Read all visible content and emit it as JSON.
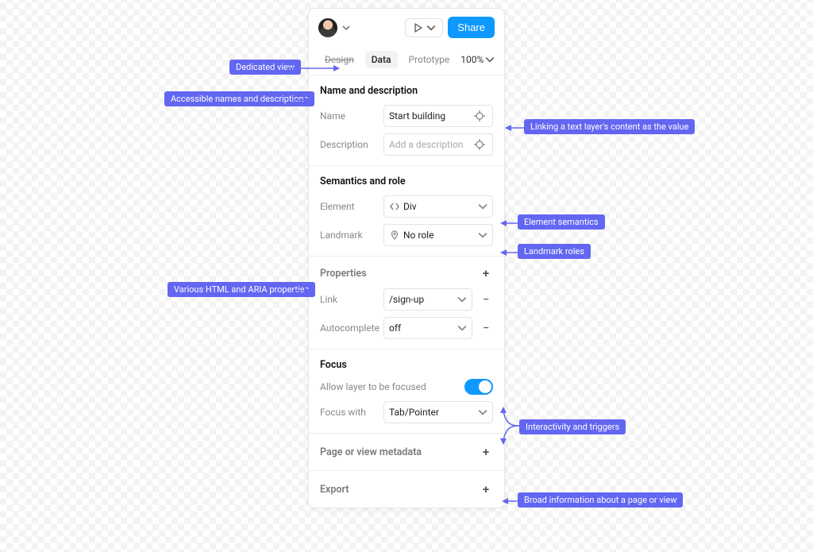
{
  "header": {
    "share_label": "Share"
  },
  "tabs": {
    "design": "Design",
    "data": "Data",
    "prototype": "Prototype",
    "zoom": "100%"
  },
  "sections": {
    "name_desc": {
      "title": "Name and description",
      "name_label": "Name",
      "name_value": "Start building",
      "desc_label": "Description",
      "desc_placeholder": "Add a description"
    },
    "semantics": {
      "title": "Semantics and role",
      "element_label": "Element",
      "element_value": "Div",
      "landmark_label": "Landmark",
      "landmark_value": "No role"
    },
    "properties": {
      "title": "Properties",
      "link_label": "Link",
      "link_value": "/sign-up",
      "autocomplete_label": "Autocomplete",
      "autocomplete_value": "off"
    },
    "focus": {
      "title": "Focus",
      "allow_label": "Allow layer to be focused",
      "focus_with_label": "Focus with",
      "focus_with_value": "Tab/Pointer"
    },
    "metadata": {
      "title": "Page or view metadata"
    },
    "export": {
      "title": "Export"
    }
  },
  "annotations": {
    "dedicated_view": "Dedicated view",
    "accessible_names": "Accessible names and descriptions",
    "linking_text": "Linking a text layer's content as the value",
    "element_semantics": "Element semantics",
    "landmark_roles": "Landmark roles",
    "html_aria": "Various HTML and ARIA properties",
    "interactivity": "Interactivity and triggers",
    "broad_info": "Broad information about a page or view"
  }
}
